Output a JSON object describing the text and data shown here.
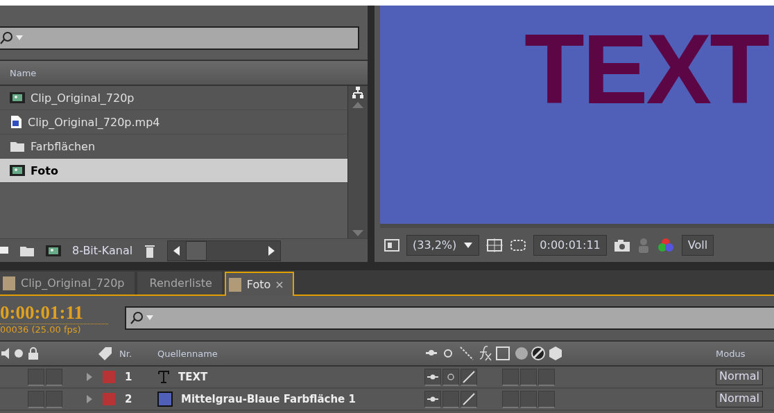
{
  "project": {
    "column": "Name",
    "items": [
      {
        "name": "Clip_Original_720p",
        "kind": "composition",
        "selected": false
      },
      {
        "name": "Clip_Original_720p.mp4",
        "kind": "video",
        "selected": false
      },
      {
        "name": "Farbflächen",
        "kind": "folder",
        "selected": false
      },
      {
        "name": "Foto",
        "kind": "composition",
        "selected": true
      }
    ],
    "depth": "8-Bit-Kanal"
  },
  "viewer": {
    "comp_text": "TEXT",
    "zoom": "(33,2%)",
    "timecode": "0:00:01:11",
    "resolution": "Voll"
  },
  "tabs": [
    {
      "label": "Clip_Original_720p",
      "selected": false
    },
    {
      "label": "Renderliste",
      "selected": false,
      "kind": "queue"
    },
    {
      "label": "Foto",
      "selected": true
    }
  ],
  "timeline": {
    "timecode": "0:00:01:11",
    "frames": "00036 (25.00 fps)",
    "number_column": "Nr.",
    "source_column": "Quellenname",
    "mode_column": "Modus",
    "layers": [
      {
        "number": "1",
        "name": "TEXT",
        "kind": "text",
        "color": "#b83434",
        "shy": true,
        "collapse": true,
        "quality": true,
        "mode": "Normal"
      },
      {
        "number": "2",
        "name": "Mittelgrau-Blaue Farbfläche 1",
        "kind": "solid",
        "color": "#b83434",
        "shy": true,
        "collapse": false,
        "quality": true,
        "mode": "Normal"
      }
    ]
  }
}
